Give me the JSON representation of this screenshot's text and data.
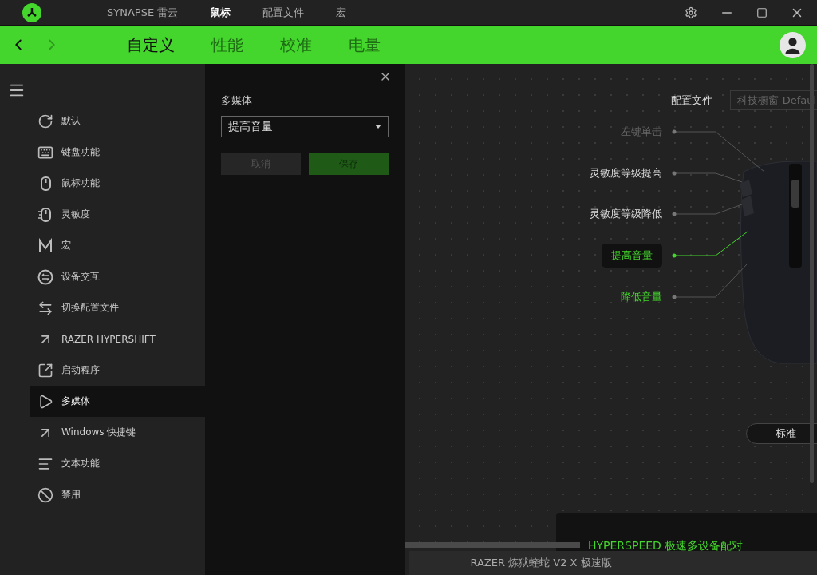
{
  "title_bar": {
    "tabs": [
      {
        "label": "SYNAPSE 雷云",
        "selected": false
      },
      {
        "label": "鼠标",
        "selected": true
      },
      {
        "label": "配置文件",
        "selected": false
      },
      {
        "label": "宏",
        "selected": false
      }
    ]
  },
  "sub_tabs": [
    {
      "label": "自定义",
      "selected": true
    },
    {
      "label": "性能",
      "selected": false
    },
    {
      "label": "校准",
      "selected": false
    },
    {
      "label": "电量",
      "selected": false
    }
  ],
  "sidebar": {
    "items": [
      {
        "label": "默认",
        "selected": false
      },
      {
        "label": "键盘功能",
        "selected": false
      },
      {
        "label": "鼠标功能",
        "selected": false
      },
      {
        "label": "灵敏度",
        "selected": false
      },
      {
        "label": "宏",
        "selected": false
      },
      {
        "label": "设备交互",
        "selected": false
      },
      {
        "label": "切换配置文件",
        "selected": false
      },
      {
        "label": "RAZER HYPERSHIFT",
        "selected": false
      },
      {
        "label": "启动程序",
        "selected": false
      },
      {
        "label": "多媒体",
        "selected": true
      },
      {
        "label": "Windows 快捷键",
        "selected": false
      },
      {
        "label": "文本功能",
        "selected": false
      },
      {
        "label": "禁用",
        "selected": false
      }
    ]
  },
  "editor": {
    "title": "多媒体",
    "select_value": "提高音量",
    "buttons": [
      {
        "label": "取消",
        "kind": "cancel"
      },
      {
        "label": "保存",
        "kind": "save"
      }
    ]
  },
  "canvas": {
    "profile_label": "配置文件",
    "profile_value": "科技橱窗-Defaul",
    "callouts": [
      {
        "label": "左键单击",
        "kind": "default"
      },
      {
        "label": "灵敏度等级提高",
        "kind": "custom"
      },
      {
        "label": "灵敏度等级降低",
        "kind": "custom"
      },
      {
        "label": "提高音量",
        "kind": "active"
      },
      {
        "label": "降低音量",
        "kind": "assigned"
      }
    ],
    "view_button": "标准",
    "pairing": "HYPERSPEED 极速多设备配对"
  },
  "footer": "RAZER 炼狱蝰蛇 V2 X 极速版"
}
